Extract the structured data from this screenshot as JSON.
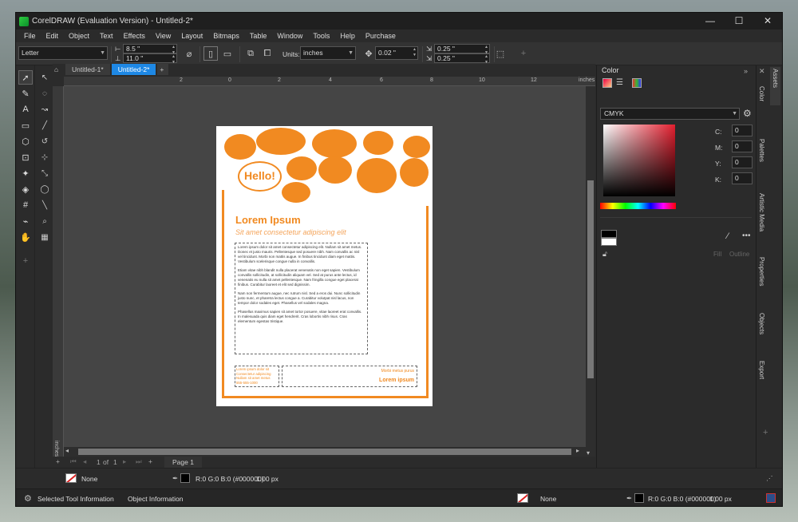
{
  "window": {
    "title": "CorelDRAW (Evaluation Version) - Untitled-2*"
  },
  "menu": [
    "File",
    "Edit",
    "Object",
    "Text",
    "Effects",
    "View",
    "Layout",
    "Bitmaps",
    "Table",
    "Window",
    "Tools",
    "Help",
    "Purchase"
  ],
  "propbar": {
    "page_size": "Letter",
    "width": "8.5 \"",
    "height": "11.0 \"",
    "units_label": "Units:",
    "units": "inches",
    "nudge": "0.02 \"",
    "dup_x": "0.25 \"",
    "dup_y": "0.25 \""
  },
  "tabs": [
    "Untitled-1*",
    "Untitled-2*"
  ],
  "ruler": {
    "h_ticks": [
      "2",
      "0",
      "2",
      "4",
      "6",
      "8",
      "10",
      "12"
    ],
    "h_unit": "inches",
    "v_unit": "inches"
  },
  "page": {
    "hello": "Hello!",
    "headline": "Lorem Ipsum",
    "subheadline": "Sit amet consectetur adipiscing elit",
    "body": [
      "Lorem ipsum dolor sit amet consectetur adipiscing elit. Nullam sit amet metus. Donec et justo mauris. Pellentesque sed posuere nibh. Nam convallis ac nisl vel tincidunt. Morbi non mattis augue. In finibus tincidunt diam eget mattis. Vestibulum scelerisque congue nulla in convallis.",
      "Etiam vitae nibh blandit nulla placerat venenatis non eget sapien. Vestibulum convallis sollicitudin, at sollicitudin aliquam vel. Sed at purus ante lectus, id venenatis eu nulla sit amet pellentesque. Nam fringilla congue eget placerat finibus. Curabitur laoreet et elit sed dignissim.",
      "Nam non fermentum augue, nec rutrum nisl. Sed a eros dui. Nunc sollicitudin justo nunc, et pharetra lectus congue a. Curabitur volutpat nisl lacus, non tempor dolor sodales eget. Phasellus vel sodales magna.",
      "Phasellus maximus sapien sit amet tortor posuere, vitae laoreet erat convallis. In malesuada quis diam eget hendrerit. Cras lobortis nibh risus. Cras elementum egestas tristique."
    ],
    "footer_left": [
      "Lorem ipsum dolor sit",
      "Consectetur adipiscing",
      "Nullam sit amet metus",
      "555-555-1000"
    ],
    "footer_right_sub": "Morbi metus purus",
    "footer_right_main": "Lorem ipsum"
  },
  "pagenav": {
    "current": "1",
    "of": "of",
    "total": "1",
    "page_tab": "Page 1"
  },
  "status": {
    "fill": "None",
    "outline": "R:0 G:0 B:0 (#000000)",
    "outline_width": "1.00 px",
    "selected_tool": "Selected Tool Information",
    "object_info": "Object Information"
  },
  "docker": {
    "title": "Color",
    "model": "CMYK",
    "labels": [
      "C:",
      "M:",
      "Y:",
      "K:"
    ],
    "values": [
      "0",
      "0",
      "0",
      "0"
    ],
    "fill_label": "Fill",
    "outline_label": "Outline",
    "accent": "#e31e2e"
  },
  "sidetabs": [
    "Assets",
    "Color",
    "Palettes",
    "Artistic Media",
    "Properties",
    "Objects",
    "Export"
  ],
  "colors": {
    "brand": "#f18a21",
    "active_tab": "#1e88e5"
  }
}
